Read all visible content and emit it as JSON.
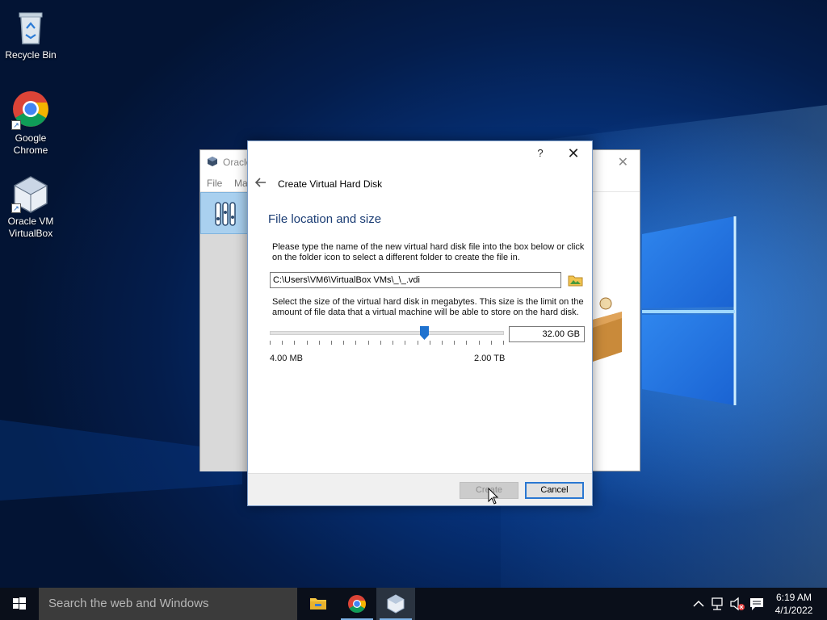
{
  "desktop": {
    "icons": [
      {
        "label": "Recycle Bin",
        "icon": "recycle-bin-icon"
      },
      {
        "label": "Google Chrome",
        "icon": "chrome-icon"
      },
      {
        "label": "Oracle VM VirtualBox",
        "icon": "virtualbox-icon"
      }
    ]
  },
  "background_window": {
    "title": "Oracle",
    "menu": [
      "File",
      "Ma"
    ]
  },
  "dialog": {
    "help_label": "?",
    "close_label": "✕",
    "wizard_title": "Create Virtual Hard Disk",
    "page_title": "File location and size",
    "location_description": "Please type the name of the new virtual hard disk file into the box below or click on the folder icon to select a different folder to create the file in.",
    "file_path": "C:\\Users\\VM6\\VirtualBox VMs\\_\\_.vdi",
    "size_description": "Select the size of the virtual hard disk in megabytes. This size is the limit on the amount of file data that a virtual machine will be able to store on the hard disk.",
    "slider": {
      "min_label": "4.00 MB",
      "max_label": "2.00 TB",
      "position_fraction": 0.66
    },
    "size_value": "32.00 GB",
    "create_label": "Create",
    "cancel_label": "Cancel"
  },
  "taskbar": {
    "search_placeholder": "Search the web and Windows",
    "apps": [
      "file-explorer-icon",
      "chrome-icon",
      "virtualbox-icon"
    ],
    "clock": {
      "time": "6:19 AM",
      "date": "4/1/2022"
    }
  },
  "colors": {
    "accent": "#2a78d2",
    "page_title": "#1b3d74",
    "taskbar": "#0a0f1a"
  }
}
